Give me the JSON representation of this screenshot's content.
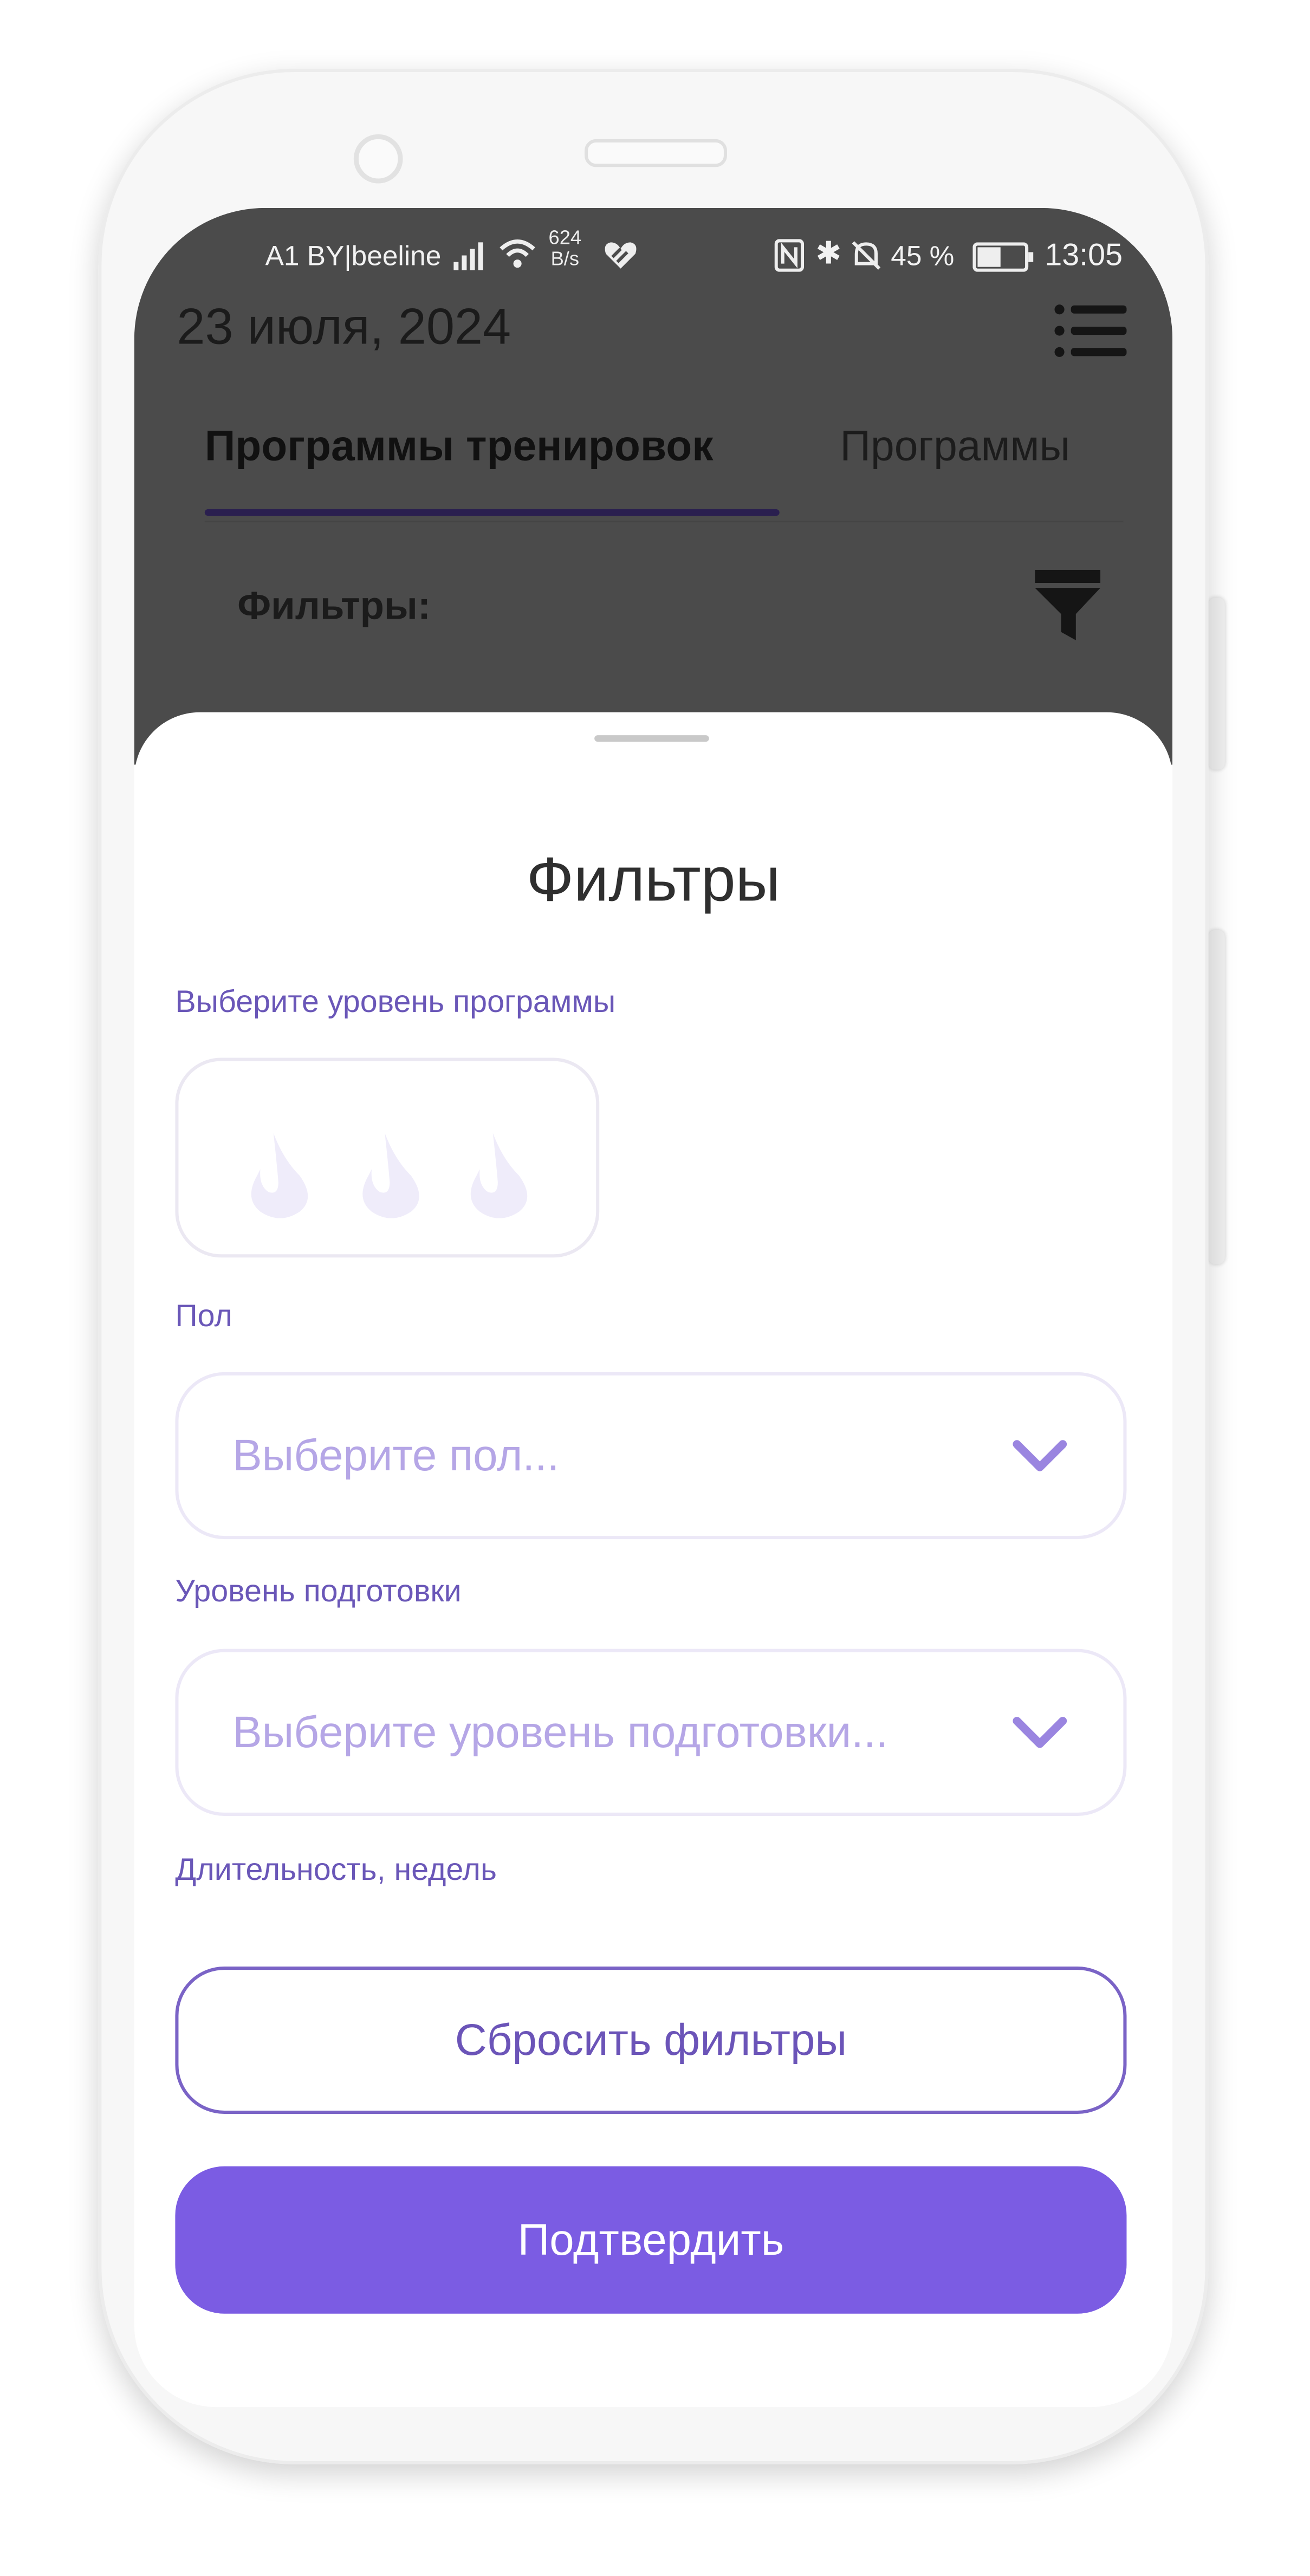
{
  "status_bar": {
    "carrier": "A1 BY|beeline",
    "speed_value": "624",
    "speed_unit": "B/s",
    "battery": "45 %",
    "time": "13:05"
  },
  "header": {
    "date": "23 июля, 2024"
  },
  "tabs": [
    {
      "label": "Программы тренировок",
      "active": true
    },
    {
      "label": "Программы",
      "active": false
    }
  ],
  "filters_bar": {
    "label": "Фильтры:"
  },
  "sheet": {
    "title": "Фильтры",
    "level_label": "Выберите уровень программы",
    "level_value": 0,
    "level_max": 3,
    "gender_label": "Пол",
    "gender_placeholder": "Выберите пол...",
    "fitness_label": "Уровень подготовки",
    "fitness_placeholder": "Выберите уровень подготовки...",
    "duration_label": "Длительность, недель",
    "reset_label": "Сбросить фильтры",
    "confirm_label": "Подтвердить"
  },
  "colors": {
    "accent": "#7b5ce3",
    "label": "#6a57b8",
    "overlay": "#4b4b4b"
  }
}
